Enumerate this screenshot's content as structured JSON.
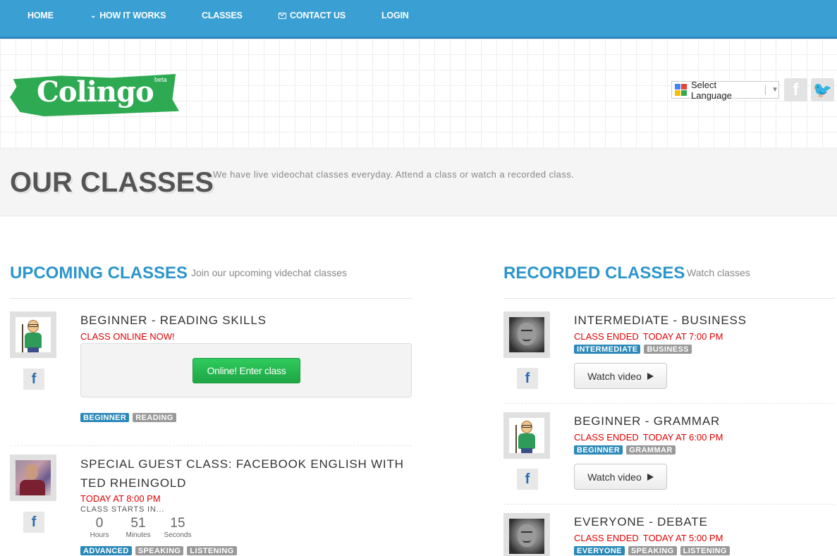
{
  "nav": {
    "home": "HOME",
    "how_it_works": "HOW IT WORKS",
    "classes": "CLASSES",
    "contact_us": "CONTACT US",
    "login": "LOGIN"
  },
  "header": {
    "logo_text": "Colingo",
    "logo_badge": "beta",
    "language_select": "Select Language"
  },
  "page": {
    "title": "OUR CLASSES",
    "subtitle": "We have live videochat classes everyday. Attend a class or watch a recorded class."
  },
  "upcoming": {
    "title": "UPCOMING CLASSES",
    "subtitle": "Join our upcoming videchat classes",
    "classes": [
      {
        "title": "BEGINNER - READING SKILLS",
        "status": "CLASS ONLINE NOW!",
        "button": "Online! Enter class",
        "tags": [
          "BEGINNER",
          "READING"
        ]
      },
      {
        "title_line1": "SPECIAL GUEST CLASS: FACEBOOK ENGLISH WITH",
        "title_line2": "TED RHEINGOLD",
        "status": "TODAY AT 8:00 PM",
        "starts_label": "CLASS STARTS IN...",
        "countdown": {
          "hours": "0",
          "hours_label": "Hours",
          "minutes": "51",
          "minutes_label": "Minutes",
          "seconds": "15",
          "seconds_label": "Seconds"
        },
        "tags": [
          "ADVANCED",
          "SPEAKING",
          "LISTENING"
        ]
      }
    ]
  },
  "recorded": {
    "title": "RECORDED CLASSES",
    "subtitle": "Watch classes",
    "watch_label": "Watch video",
    "classes": [
      {
        "title": "INTERMEDIATE - BUSINESS",
        "status": "CLASS ENDED",
        "time": "TODAY AT 7:00 PM",
        "tags": [
          "INTERMEDIATE",
          "BUSINESS"
        ]
      },
      {
        "title": "BEGINNER - GRAMMAR",
        "status": "CLASS ENDED",
        "time": "TODAY AT 6:00 PM",
        "tags": [
          "BEGINNER",
          "GRAMMAR"
        ]
      },
      {
        "title": "EVERYONE - DEBATE",
        "status": "CLASS ENDED",
        "time": "TODAY AT 5:00 PM",
        "tags": [
          "EVERYONE",
          "SPEAKING",
          "LISTENING"
        ]
      }
    ]
  },
  "icons": {
    "facebook": "facebook-icon",
    "twitter": "twitter-icon",
    "google": "google-translate-icon",
    "mail": "mail-icon",
    "chevron": "chevron-down-icon",
    "play": "play-icon"
  },
  "colors": {
    "nav_bg": "#3a9fd3",
    "accent_blue": "#2b95cc",
    "status_red": "#e00000",
    "enter_green": "#1ea646",
    "logo_green": "#2eaa52",
    "tag_blue": "#2b89b8",
    "tag_grey": "#999999"
  }
}
